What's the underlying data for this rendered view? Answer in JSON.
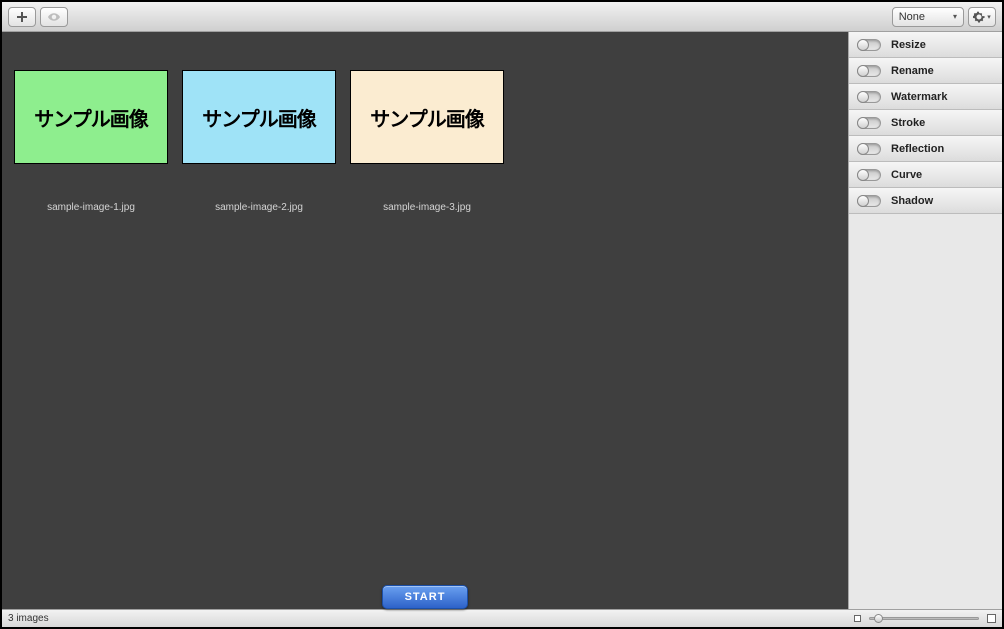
{
  "toolbar": {
    "preset_selected": "None"
  },
  "thumbnails": [
    {
      "text": "サンプル画像",
      "filename": "sample-image-1.jpg",
      "bg": "#8eee8e"
    },
    {
      "text": "サンプル画像",
      "filename": "sample-image-2.jpg",
      "bg": "#9fe3f7"
    },
    {
      "text": "サンプル画像",
      "filename": "sample-image-3.jpg",
      "bg": "#fbecd1"
    }
  ],
  "sidebar_options": [
    {
      "label": "Resize"
    },
    {
      "label": "Rename"
    },
    {
      "label": "Watermark"
    },
    {
      "label": "Stroke"
    },
    {
      "label": "Reflection"
    },
    {
      "label": "Curve"
    },
    {
      "label": "Shadow"
    }
  ],
  "start_label": "START",
  "status_text": "3 images"
}
